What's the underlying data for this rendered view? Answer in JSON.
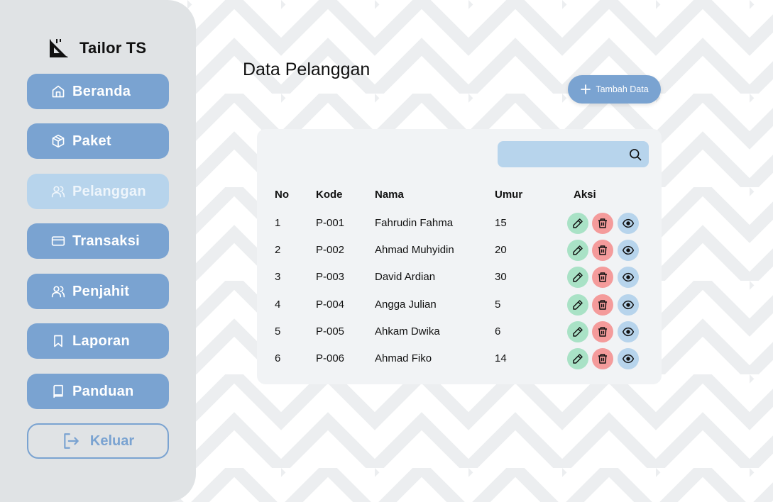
{
  "app": {
    "name": "Tailor TS"
  },
  "sidebar": {
    "items": [
      {
        "label": "Beranda",
        "icon": "home-icon"
      },
      {
        "label": "Paket",
        "icon": "package-icon"
      },
      {
        "label": "Pelanggan",
        "icon": "users-icon",
        "active": true
      },
      {
        "label": "Transaksi",
        "icon": "credit-card-icon"
      },
      {
        "label": "Penjahit",
        "icon": "users-icon"
      },
      {
        "label": "Laporan",
        "icon": "bookmark-icon"
      },
      {
        "label": "Panduan",
        "icon": "book-icon"
      }
    ],
    "logout_label": "Keluar"
  },
  "main": {
    "title": "Data Pelanggan",
    "add_button_label": "Tambah Data",
    "search": {
      "value": "",
      "placeholder": ""
    },
    "table": {
      "headers": [
        "No",
        "Kode",
        "Nama",
        "Umur",
        "Aksi"
      ],
      "rows": [
        [
          "1",
          "P-001",
          "Fahrudin Fahma",
          "15"
        ],
        [
          "2",
          "P-002",
          "Ahmad Muhyidin",
          "20"
        ],
        [
          "3",
          "P-003",
          "David Ardian",
          "30"
        ],
        [
          "4",
          "P-004",
          "Angga Julian",
          "5"
        ],
        [
          "5",
          "P-005",
          "Ahkam Dwika",
          "6"
        ],
        [
          "6",
          "P-006",
          "Ahmad Fiko",
          "14"
        ]
      ]
    }
  },
  "colors": {
    "sidebar_bg": "#e0e3e5",
    "nav_button": "#7aa3d1",
    "nav_active": "#b7d4ec",
    "card_bg": "#f1f3f5",
    "edit": "#a9e2c6",
    "delete": "#f49b9b",
    "view": "#b7d4ec"
  }
}
